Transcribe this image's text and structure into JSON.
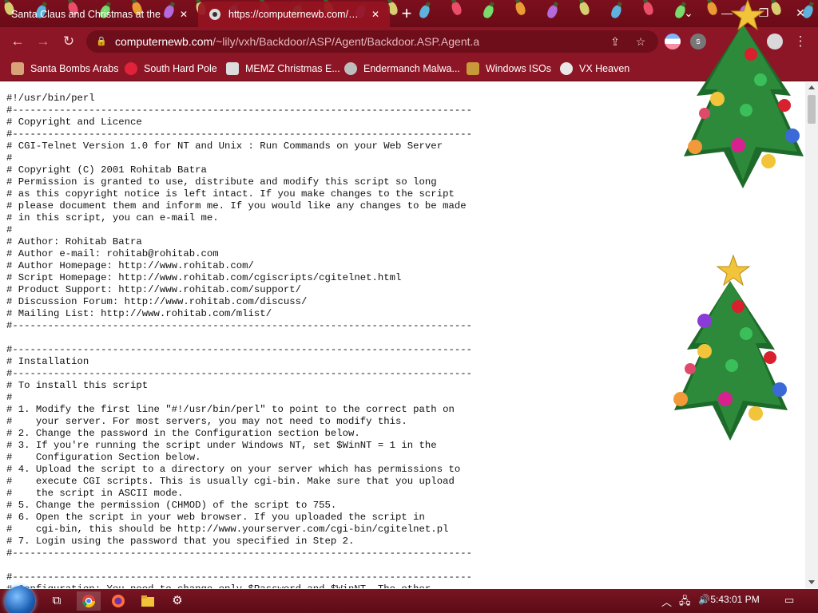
{
  "tabs": [
    {
      "title": "Santa Claus and Christmas at the",
      "active": false
    },
    {
      "title": "https://computernewb.com/~lily",
      "active": true
    }
  ],
  "window_controls": {
    "minimize": "—",
    "maximize": "❐",
    "close": "✕",
    "tab_search": "⌄"
  },
  "omnibox": {
    "host": "computernewb.com",
    "path": "/~lily/vxh/Backdoor/ASP/Agent/Backdoor.ASP.Agent.a"
  },
  "bookmarks": [
    {
      "label": "Santa Bombs Arabs",
      "icon": "santa-icon",
      "color": "#d9a37a"
    },
    {
      "label": "South Hard Pole",
      "icon": "star-flake-icon",
      "color": "#e0233a"
    },
    {
      "label": "MEMZ Christmas E...",
      "icon": "page-icon",
      "color": "#dcdcdc"
    },
    {
      "label": "Endermanch Malwa...",
      "icon": "raccoon-icon",
      "color": "#bdbdbd"
    },
    {
      "label": "Windows ISOs",
      "icon": "figure-icon",
      "color": "#c79a3a"
    },
    {
      "label": "VX Heaven",
      "icon": "vx-icon",
      "color": "#e8e8e8"
    }
  ],
  "code_text": "#!/usr/bin/perl\n#------------------------------------------------------------------------------\n# Copyright and Licence\n#------------------------------------------------------------------------------\n# CGI-Telnet Version 1.0 for NT and Unix : Run Commands on your Web Server\n#\n# Copyright (C) 2001 Rohitab Batra\n# Permission is granted to use, distribute and modify this script so long\n# as this copyright notice is left intact. If you make changes to the script\n# please document them and inform me. If you would like any changes to be made\n# in this script, you can e-mail me.\n#\n# Author: Rohitab Batra\n# Author e-mail: rohitab@rohitab.com\n# Author Homepage: http://www.rohitab.com/\n# Script Homepage: http://www.rohitab.com/cgiscripts/cgitelnet.html\n# Product Support: http://www.rohitab.com/support/\n# Discussion Forum: http://www.rohitab.com/discuss/\n# Mailing List: http://www.rohitab.com/mlist/\n#------------------------------------------------------------------------------\n\n#------------------------------------------------------------------------------\n# Installation\n#------------------------------------------------------------------------------\n# To install this script\n#\n# 1. Modify the first line \"#!/usr/bin/perl\" to point to the correct path on\n#    your server. For most servers, you may not need to modify this.\n# 2. Change the password in the Configuration section below.\n# 3. If you're running the script under Windows NT, set $WinNT = 1 in the\n#    Configuration Section below.\n# 4. Upload the script to a directory on your server which has permissions to\n#    execute CGI scripts. This is usually cgi-bin. Make sure that you upload\n#    the script in ASCII mode.\n# 5. Change the permission (CHMOD) of the script to 755.\n# 6. Open the script in your web browser. If you uploaded the script in\n#    cgi-bin, this should be http://www.yourserver.com/cgi-bin/cgitelnet.pl\n# 7. Login using the password that you specified in Step 2.\n#------------------------------------------------------------------------------\n\n#------------------------------------------------------------------------------\n# Configuration: You need to change only $Password and $WinNT. The other",
  "taskbar": {
    "clock": "5:43:01 PM",
    "apps": [
      "task-view-icon",
      "chrome-icon",
      "firefox-icon",
      "file-explorer-icon",
      "script-app-icon"
    ]
  },
  "theme": {
    "accent": "#8d1626",
    "tabstrip": "#6a0b17",
    "taskbar": "#5a0c17"
  }
}
